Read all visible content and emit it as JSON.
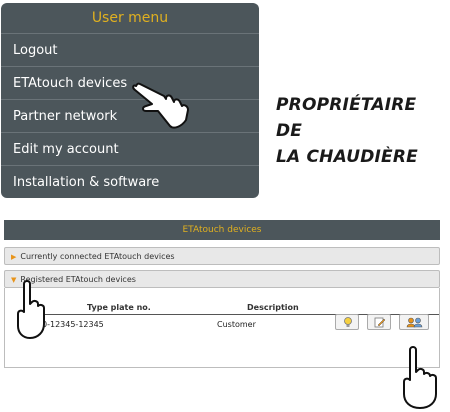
{
  "user_menu": {
    "title": "User menu",
    "items": [
      {
        "label": "Logout"
      },
      {
        "label": "ETAtouch devices"
      },
      {
        "label": "Partner network"
      },
      {
        "label": "Edit my account"
      },
      {
        "label": "Installation & software"
      }
    ]
  },
  "caption": {
    "line1": "PROPRIÉTAIRE DE",
    "line2": "LA CHAUDIÈRE"
  },
  "etatouch_panel": {
    "title": "ETAtouch devices",
    "sections": [
      {
        "label": "Currently connected ETAtouch devices"
      },
      {
        "label": "Registered ETAtouch devices"
      }
    ],
    "columns": [
      "Type plate no.",
      "Description"
    ],
    "rows": [
      {
        "type_plate": "P820-12345-12345",
        "description": "Customer"
      }
    ],
    "action_icons": [
      "lightbulb-icon",
      "edit-icon",
      "users-icon"
    ]
  },
  "colors": {
    "panel_bg": "#4c565b",
    "title_accent": "#e0b020",
    "section_arrow": "#e8941a"
  }
}
